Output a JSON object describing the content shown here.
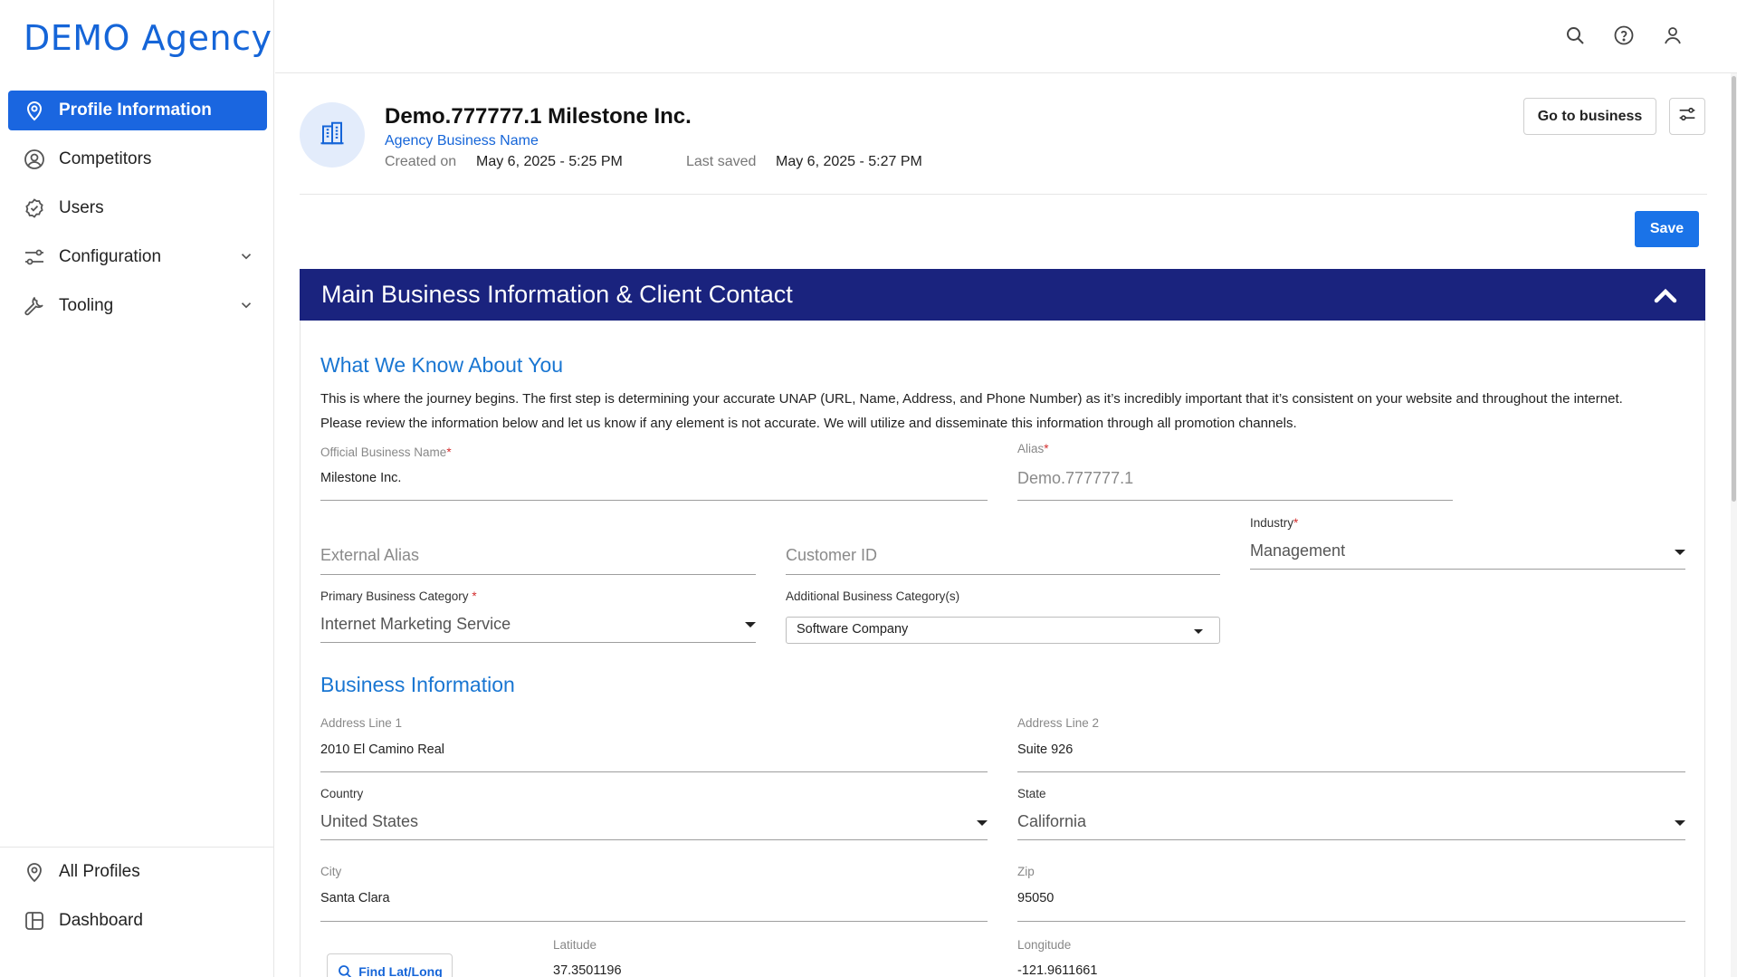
{
  "sidebar": {
    "logo": "DEMO Agency",
    "items": [
      {
        "label": "Profile Information",
        "icon": "location-pin-icon",
        "active": true
      },
      {
        "label": "Competitors",
        "icon": "user-circle-icon"
      },
      {
        "label": "Users",
        "icon": "check-circle-icon"
      },
      {
        "label": "Configuration",
        "icon": "sliders-icon",
        "expandable": true
      },
      {
        "label": "Tooling",
        "icon": "wrench-icon",
        "expandable": true
      }
    ],
    "bottom_items": [
      {
        "label": "All Profiles",
        "icon": "location-pin-icon"
      },
      {
        "label": "Dashboard",
        "icon": "dashboard-icon"
      }
    ]
  },
  "topbar": {
    "icons": [
      "search-icon",
      "help-icon",
      "user-icon"
    ]
  },
  "header": {
    "business_name": "Demo.777777.1 Milestone Inc.",
    "subtitle": "Agency Business Name",
    "created_label": "Created on",
    "created_value": "May 6, 2025 - 5:25 PM",
    "saved_label": "Last saved",
    "saved_value": "May 6, 2025 - 5:27 PM",
    "goto_label": "Go to business",
    "save_label": "Save"
  },
  "panel": {
    "title": "Main Business Information & Client Contact",
    "section1_title": "What We Know About You",
    "intro_line1": "This is where the journey begins. The first step is determining your accurate UNAP (URL, Name, Address, and Phone Number) as it’s incredibly important that it’s consistent on your website and throughout the internet.",
    "intro_line2": "Please review the information below and let us know if any element is not accurate. We will utilize and disseminate this information through all promotion channels.",
    "fields": {
      "official_name": {
        "label": "Official Business Name",
        "value": "Milestone Inc."
      },
      "alias": {
        "label": "Alias",
        "value": "Demo.777777.1"
      },
      "external_alias": {
        "placeholder": "External Alias"
      },
      "customer_id": {
        "placeholder": "Customer ID"
      },
      "industry": {
        "label": "Industry",
        "value": "Management"
      },
      "primary_category": {
        "label": "Primary Business Category ",
        "value": "Internet Marketing Service"
      },
      "additional_category": {
        "label": "Additional Business Category(s)",
        "value": "Software Company"
      }
    },
    "section2_title": "Business Information",
    "address": {
      "line1": {
        "label": "Address Line 1",
        "value": "2010 El Camino Real"
      },
      "line2": {
        "label": "Address Line 2",
        "value": "Suite 926"
      },
      "country": {
        "label": "Country",
        "value": "United States"
      },
      "state": {
        "label": "State",
        "value": "California"
      },
      "city": {
        "label": "City",
        "value": "Santa Clara"
      },
      "zip": {
        "label": "Zip",
        "value": "95050"
      },
      "find_label": "Find Lat/Long",
      "latitude": {
        "label": "Latitude",
        "value": "37.3501196"
      },
      "longitude": {
        "label": "Longitude",
        "value": "-121.9611661"
      }
    }
  },
  "colors": {
    "accent": "#1a66e0",
    "panel_header": "#1a237e",
    "section_title": "#1976d2",
    "required": "#d32f2f"
  }
}
